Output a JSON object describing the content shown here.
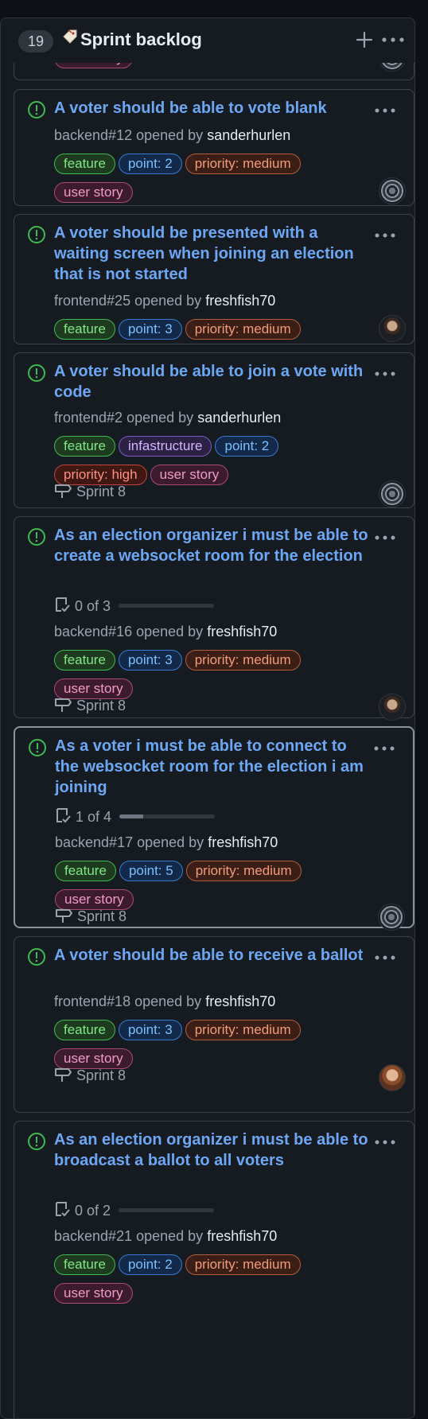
{
  "column": {
    "count": "19",
    "title": "Sprint backlog"
  },
  "cards": [
    {
      "title": "A voter should be able to vote blank",
      "ref": "backend#12",
      "opened_by": "opened by",
      "author": "sanderhurlen",
      "labels": [
        "feature",
        "point: 2",
        "priority: medium",
        "user story"
      ],
      "milestone": "",
      "avatar": "gear"
    },
    {
      "title": "A voter should be presented with a waiting screen when joining an election that is not started",
      "ref": "frontend#25",
      "opened_by": "opened by",
      "author": "freshfish70",
      "labels": [
        "feature",
        "point: 3",
        "priority: medium"
      ],
      "milestone": "",
      "avatar": "dark"
    },
    {
      "title": "A voter should be able to join a vote with code",
      "ref": "frontend#2",
      "opened_by": "opened by",
      "author": "sanderhurlen",
      "labels": [
        "feature",
        "infastructure",
        "point: 2",
        "priority: high",
        "user story"
      ],
      "milestone": "Sprint 8",
      "avatar": "gear"
    },
    {
      "title": "As an election organizer i must be able to create a websocket room for the election",
      "tasks": "0 of 3",
      "tasks_done": 0,
      "tasks_total": 3,
      "ref": "backend#16",
      "opened_by": "opened by",
      "author": "freshfish70",
      "labels": [
        "feature",
        "point: 3",
        "priority: medium",
        "user story"
      ],
      "milestone": "Sprint 8",
      "avatar": "dark"
    },
    {
      "title": "As a voter i must be able to connect to the websocket room for the election i am joining",
      "tasks": "1 of 4",
      "tasks_done": 1,
      "tasks_total": 4,
      "ref": "backend#17",
      "opened_by": "opened by",
      "author": "freshfish70",
      "labels": [
        "feature",
        "point: 5",
        "priority: medium",
        "user story"
      ],
      "milestone": "Sprint 8",
      "avatar": "gear"
    },
    {
      "title": "A voter should be able to receive a ballot",
      "ref": "frontend#18",
      "opened_by": "opened by",
      "author": "freshfish70",
      "labels": [
        "feature",
        "point: 3",
        "priority: medium",
        "user story"
      ],
      "milestone": "Sprint 8",
      "avatar": "brown"
    },
    {
      "title": "As an election organizer i must be able to broadcast a ballot to all voters",
      "tasks": "0 of 2",
      "tasks_done": 0,
      "tasks_total": 2,
      "ref": "backend#21",
      "opened_by": "opened by",
      "author": "freshfish70",
      "labels": [
        "feature",
        "point: 2",
        "priority: medium",
        "user story"
      ],
      "milestone": "",
      "avatar": ""
    }
  ],
  "partial_card_label": "user story",
  "colors": {
    "accent_blue": "#6ca7f4",
    "open_icon": "#3fb950"
  }
}
